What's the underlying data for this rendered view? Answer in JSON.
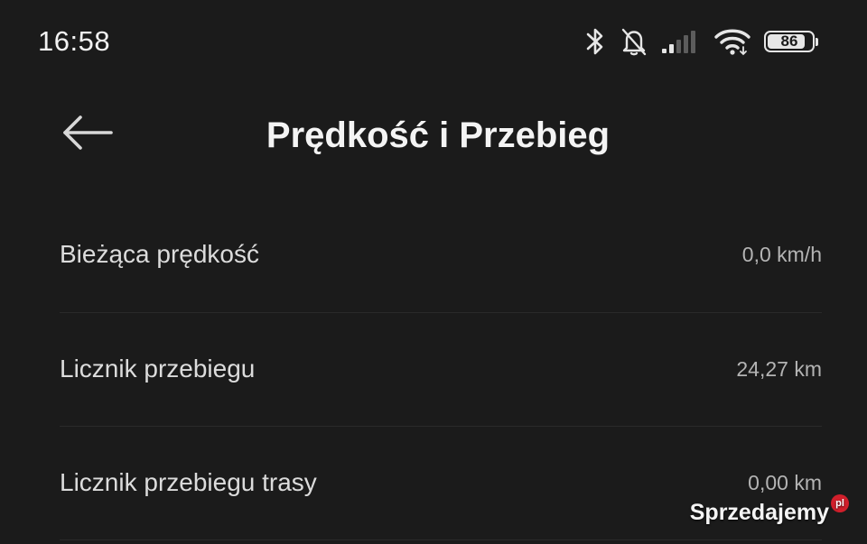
{
  "status_bar": {
    "time": "16:58",
    "battery_percent": "86",
    "battery_level": 0.86,
    "icons": [
      "bluetooth-icon",
      "bell-off-icon",
      "signal-icon",
      "wifi-icon",
      "battery-icon"
    ]
  },
  "header": {
    "title": "Prędkość i Przebieg",
    "back_icon": "arrow-left-icon"
  },
  "rows": [
    {
      "label": "Bieżąca prędkość",
      "value": "0,0 km/h"
    },
    {
      "label": "Licznik przebiegu",
      "value": "24,27 km"
    },
    {
      "label": "Licznik przebiegu trasy",
      "value": "0,00 km"
    }
  ],
  "watermark": {
    "text": "Sprzedajemy",
    "badge": "pl"
  },
  "colors": {
    "background": "#1b1b1b",
    "text_primary": "#f4f4f4",
    "text_secondary": "#b4b4b4",
    "watermark_badge": "#d11f2b"
  }
}
